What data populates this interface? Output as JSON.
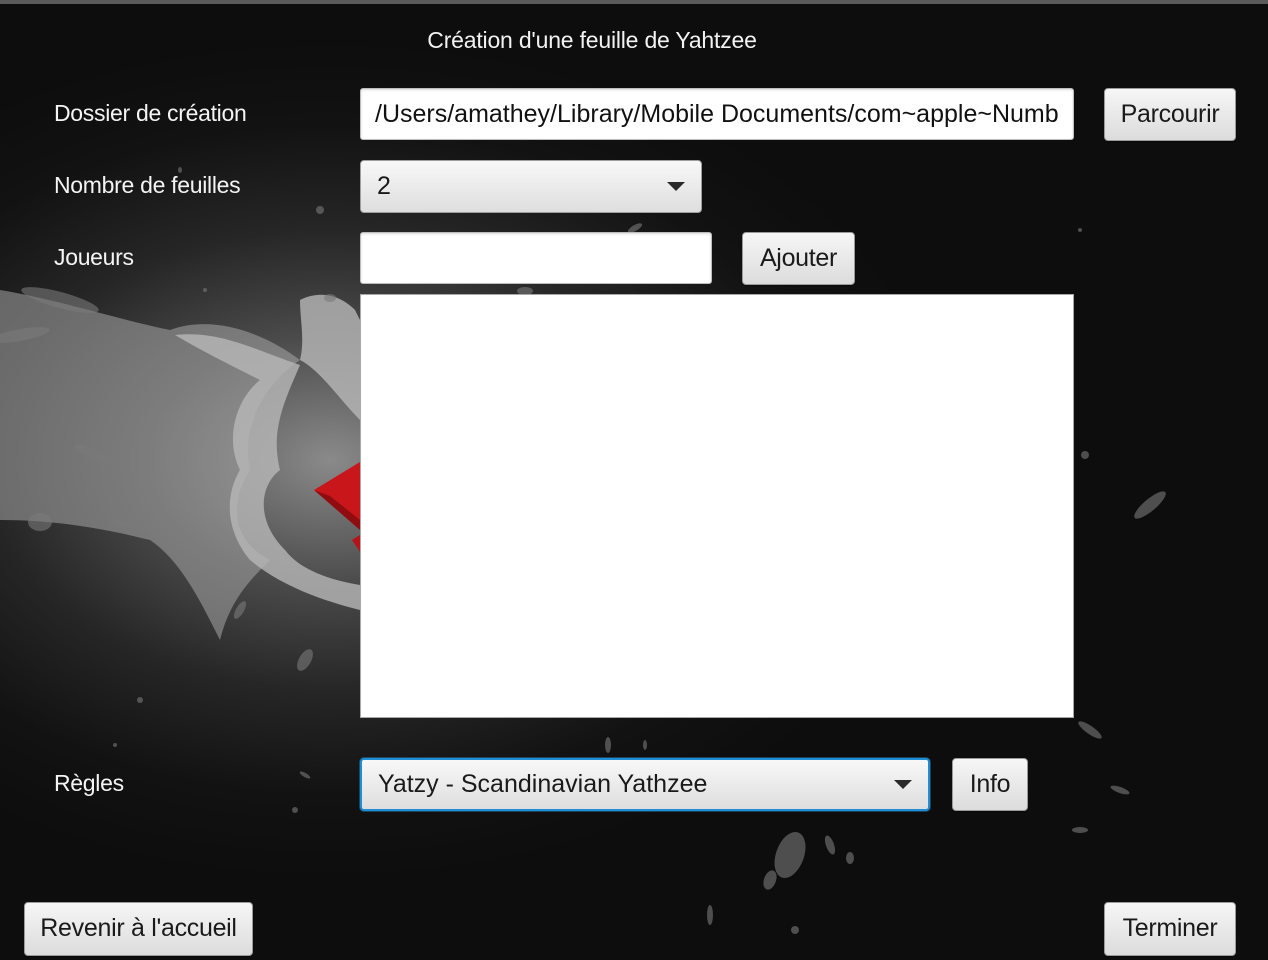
{
  "window": {
    "title": "Création d'une feuille de Yahtzee"
  },
  "form": {
    "folder": {
      "label": "Dossier de création",
      "value": "/Users/amathey/Library/Mobile Documents/com~apple~Numb",
      "browse_label": "Parcourir"
    },
    "sheets": {
      "label": "Nombre de feuilles",
      "selected": "2"
    },
    "players": {
      "label": "Joueurs",
      "input_value": "",
      "add_label": "Ajouter",
      "list": []
    },
    "rules": {
      "label": "Règles",
      "selected": "Yatzy - Scandinavian Yathzee",
      "info_label": "Info"
    }
  },
  "footer": {
    "back_label": "Revenir à l'accueil",
    "finish_label": "Terminer"
  },
  "colors": {
    "focus_accent": "#1d8fd6",
    "dice_red": "#c8161b"
  }
}
